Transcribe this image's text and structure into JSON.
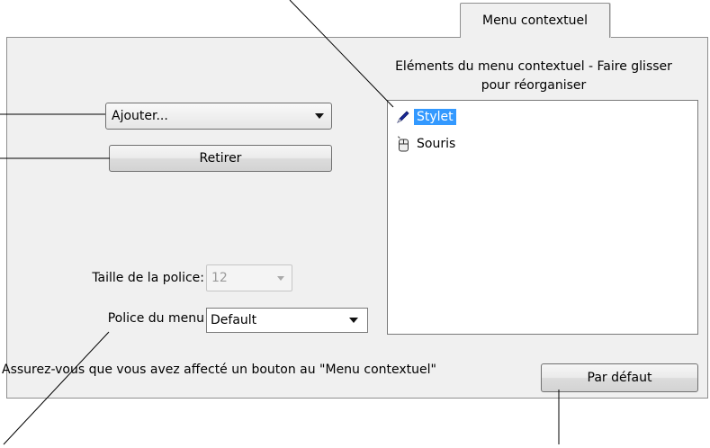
{
  "tab": {
    "label": "Menu contextuel"
  },
  "left": {
    "add_dropdown": {
      "value": "Ajouter..."
    },
    "remove_button": {
      "label": "Retirer"
    },
    "font_size": {
      "label": "Taille de la police:",
      "value": "12"
    },
    "menu_font": {
      "label": "Police du menu",
      "value": "Default"
    }
  },
  "list": {
    "heading_line1": "Eléments du menu contextuel - Faire glisser",
    "heading_line2": "pour réorganiser",
    "items": [
      {
        "label": "Stylet",
        "icon": "pen-icon",
        "selected": true
      },
      {
        "label": "Souris",
        "icon": "mouse-icon",
        "selected": false
      }
    ]
  },
  "footer": {
    "note": "Assurez-vous que vous avez affecté un bouton au \"Menu contextuel\"",
    "default_button": {
      "label": "Par défaut"
    }
  },
  "colors": {
    "selection": "#3399ff",
    "panel": "#f0f0f0"
  }
}
